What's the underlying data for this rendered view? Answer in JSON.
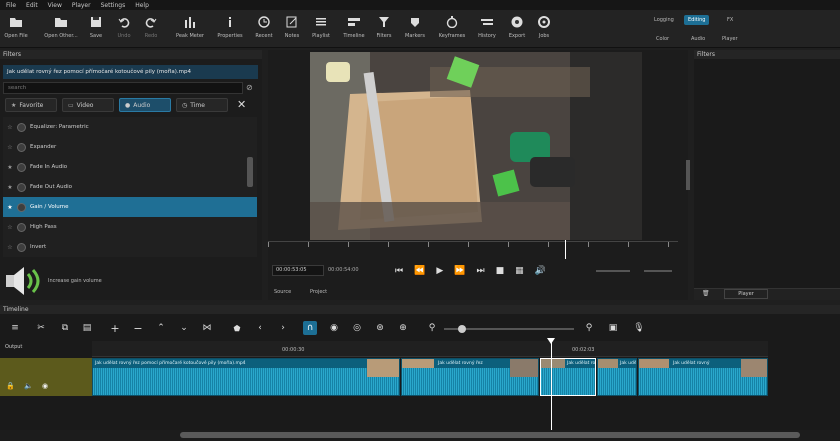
{
  "menu": [
    "File",
    "Edit",
    "View",
    "Player",
    "Settings",
    "Help"
  ],
  "toolbar": [
    {
      "label": "Open File",
      "icon": "folder-open-icon"
    },
    {
      "label": "Open Other...",
      "icon": "folder-icon"
    },
    {
      "label": "Save",
      "icon": "save-icon"
    },
    {
      "label": "Undo",
      "icon": "undo-icon"
    },
    {
      "label": "Redo",
      "icon": "redo-icon"
    },
    {
      "label": "Peak Meter",
      "icon": "peak-meter-icon"
    },
    {
      "label": "Properties",
      "icon": "info-icon"
    },
    {
      "label": "Recent",
      "icon": "clock-icon"
    },
    {
      "label": "Notes",
      "icon": "notes-icon"
    },
    {
      "label": "Playlist",
      "icon": "playlist-icon"
    },
    {
      "label": "Timeline",
      "icon": "timeline-icon"
    },
    {
      "label": "Filters",
      "icon": "filter-icon"
    },
    {
      "label": "Markers",
      "icon": "marker-icon"
    },
    {
      "label": "Keyframes",
      "icon": "stopwatch-icon"
    },
    {
      "label": "History",
      "icon": "history-icon"
    },
    {
      "label": "Export",
      "icon": "export-icon"
    },
    {
      "label": "Jobs",
      "icon": "jobs-icon"
    }
  ],
  "layouts": {
    "row1": [
      "Logging",
      "Editing",
      "FX"
    ],
    "row2": [
      "Color",
      "Audio",
      "Player"
    ],
    "active": "Editing"
  },
  "filters_panel": {
    "title": "Filters",
    "selected_clip": "Jak udělat rovný řez pomocí přímočaré kotoučové pily (mořla).mp4",
    "search_placeholder": "search",
    "tabs": [
      "Favorite",
      "Video",
      "Audio",
      "Time"
    ],
    "items": [
      {
        "label": "Equalizer: Parametric",
        "selected": false
      },
      {
        "label": "Expander",
        "selected": false
      },
      {
        "label": "Fade In Audio",
        "selected": false
      },
      {
        "label": "Fade Out Audio",
        "selected": false
      },
      {
        "label": "Gain / Volume",
        "selected": true
      },
      {
        "label": "High Pass",
        "selected": false
      },
      {
        "label": "Invert",
        "selected": false
      }
    ],
    "preview_text": "Increase gain volume"
  },
  "player": {
    "position": "00:00:53:05",
    "duration": "00:00:54:00",
    "tabs": [
      "Source",
      "Project"
    ]
  },
  "properties": {
    "title": "Filters",
    "footer_label": "Player"
  },
  "timeline": {
    "title": "Timeline",
    "track_label": "Output",
    "marks": [
      "00:00:30",
      "00:02:03"
    ],
    "clips": [
      {
        "name": "Jak udělat rovný řez pomocí přímočaré kotoučové pily (mořla).mp4"
      },
      {
        "name": "Jak udělat rovný řez"
      },
      {
        "name": "Jak udělat rovný"
      },
      {
        "name": "Jak udělat"
      },
      {
        "name": "Jak udělat rovný"
      }
    ]
  }
}
